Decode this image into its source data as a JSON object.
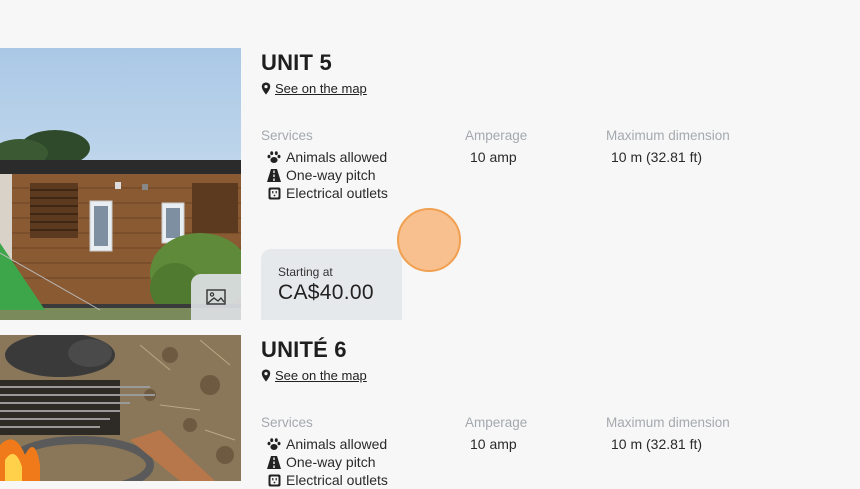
{
  "units": [
    {
      "title": "UNIT 5",
      "map_link": "See on the map",
      "services_header": "Services",
      "services": [
        "Animals allowed",
        "One-way pitch",
        "Electrical outlets"
      ],
      "amperage_header": "Amperage",
      "amperage": "10 amp",
      "dimension_header": "Maximum dimension",
      "dimension": "10 m (32.81 ft)",
      "price_label": "Starting at",
      "price": "CA$40.00"
    },
    {
      "title": "UNITÉ 6",
      "map_link": "See on the map",
      "services_header": "Services",
      "services": [
        "Animals allowed",
        "One-way pitch",
        "Electrical outlets"
      ],
      "amperage_header": "Amperage",
      "amperage": "10 amp",
      "dimension_header": "Maximum dimension",
      "dimension": "10 m (32.81 ft)"
    }
  ],
  "icons": {
    "map_pin": "map-pin-icon",
    "animals": "paw-icon",
    "pitch": "road-icon",
    "outlets": "outlet-icon",
    "gallery": "image-icon"
  },
  "colors": {
    "background": "#f7f7f8",
    "price_box": "#e6e9ec",
    "muted_header": "#a5a9ad",
    "cursor": "#f8c08f"
  }
}
